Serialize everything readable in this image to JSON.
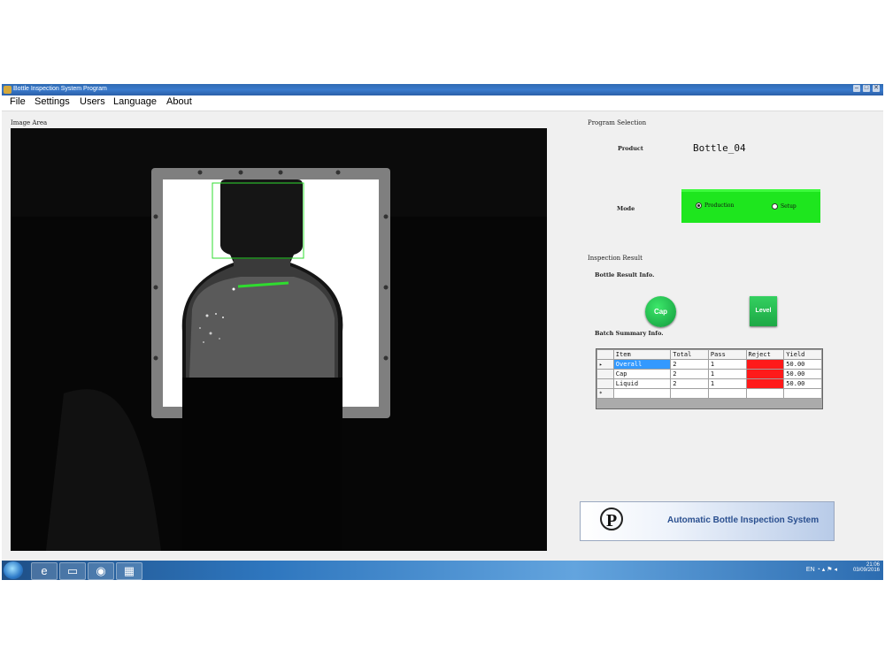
{
  "window": {
    "title": "Bottle Inspection System Program",
    "controls": [
      "–",
      "□",
      "✕"
    ]
  },
  "menu": [
    "File",
    "Settings",
    "Users",
    "Language",
    "About"
  ],
  "image_area": {
    "label": "Image Area"
  },
  "program_selection": {
    "label": "Program Selection",
    "product_label": "Product",
    "product_value": "Bottle_04",
    "mode_label": "Mode",
    "modes": [
      {
        "label": "Production",
        "selected": true
      },
      {
        "label": "Setup",
        "selected": false
      }
    ],
    "mode_color": "#1ee61e"
  },
  "inspection_result": {
    "label": "Inspection Result",
    "bottle_result_label": "Bottle Result Info.",
    "cap_label": "Cap",
    "level_label": "Level",
    "batch_summary_label": "Batch Summary Info."
  },
  "batch_table": {
    "columns": [
      "Item",
      "Total",
      "Pass",
      "Reject",
      "Yield"
    ],
    "rows": [
      {
        "item": "Overall",
        "total": "2",
        "pass": "1",
        "reject": "",
        "yield": "50.00"
      },
      {
        "item": "Cap",
        "total": "2",
        "pass": "1",
        "reject": "",
        "yield": "50.00"
      },
      {
        "item": "Liquid",
        "total": "2",
        "pass": "1",
        "reject": "",
        "yield": "50.00"
      }
    ],
    "current_row_marker": "▸",
    "new_row_marker": "*",
    "reject_color": "#ff1a1a"
  },
  "banner": {
    "title": "Automatic Bottle Inspection System",
    "logo_letter": "P"
  },
  "taskbar": {
    "apps": [
      "start-orb",
      "ie-icon",
      "folder-icon",
      "media-icon",
      "app-icon"
    ],
    "lang": "EN",
    "time": "21:06",
    "date": "03/09/2016"
  }
}
